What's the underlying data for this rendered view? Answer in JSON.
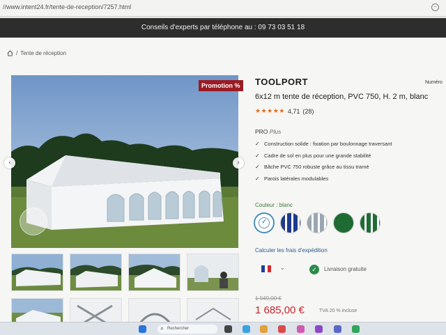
{
  "browser": {
    "url": "//www.intent24.fr/tente-de-reception/7257.html"
  },
  "header": {
    "phone_text": "Conseils d'experts par téléphone au : 09 73 03 51 18"
  },
  "breadcrumb": {
    "home_icon": "home-icon",
    "current": "Tente de réception"
  },
  "gallery": {
    "promo_badge": "Promotion %"
  },
  "product": {
    "brand": "TOOLPORT",
    "numero_label": "Numéro",
    "title": "6x12 m tente de réception, PVC 750, H. 2 m, blanc",
    "rating_stars": "★★★★★",
    "rating_value": "4,71",
    "rating_count": "(28)",
    "pro_label": "PRO",
    "pro_suffix": "Plus",
    "features": [
      "Construction solide : fixation par boulonnage traversant",
      "Cadre de sol en plus pour une grande stabilité",
      "Bâche PVC 750 robuste grâce au tissu tramé",
      "Parois latérales modulables"
    ],
    "color_label": "Couleur : blanc",
    "shipping_label": "Calculer les frais d'expédition",
    "free_shipping": "Livraison gratuite",
    "old_price": "1 949,00 €",
    "price": "1 685,00 €",
    "vat_note": "TVA 20 % incluse"
  },
  "taskbar": {
    "search_placeholder": "Rechercher"
  },
  "colors": {
    "accent_red": "#c2262e",
    "promo_bg": "#9b1b24",
    "rating_orange": "#e06a1b",
    "free_green": "#2c8a4a"
  }
}
